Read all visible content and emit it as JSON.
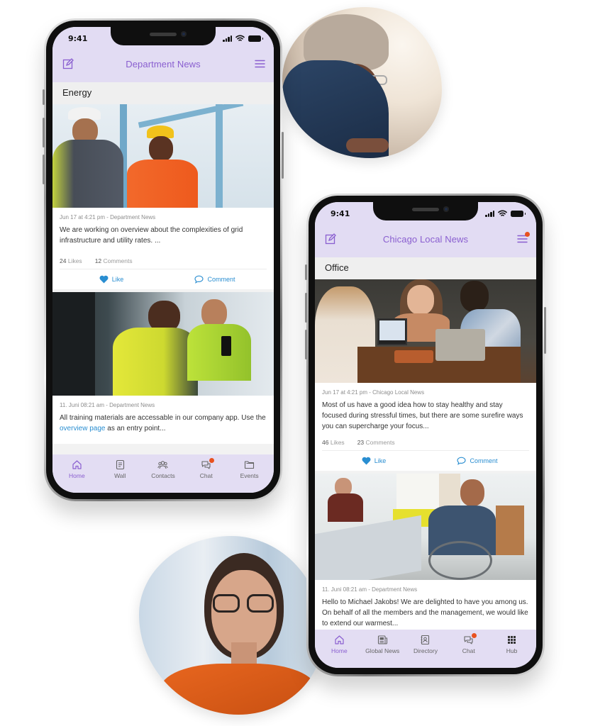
{
  "phones": [
    {
      "status_time": "9:41",
      "header_title": "Department News",
      "section": "Energy",
      "menu_badge": false,
      "posts": [
        {
          "image": "workers-hardhats-photo",
          "meta": "Jun 17 at 4:21 pm - Department News",
          "text": "We are working  on overview about the complexities of grid infrastructure and utility rates. ...",
          "likes_count": "24",
          "likes_label": "Likes",
          "comments_count": "12",
          "comments_label": "Comments",
          "like_button": "Like",
          "comment_button": "Comment"
        },
        {
          "image": "workers-in-vehicle-photo",
          "meta": "11. Juni 08:21 am - Department News",
          "text_before_link": "All training materials are accessable in our company app. Use the ",
          "link": "overview page",
          "text_after_link": " as an entry point..."
        }
      ],
      "tabs": [
        {
          "label": "Home",
          "icon": "home-icon",
          "active": true
        },
        {
          "label": "Wall",
          "icon": "wall-icon",
          "active": false
        },
        {
          "label": "Contacts",
          "icon": "contacts-icon",
          "active": false
        },
        {
          "label": "Chat",
          "icon": "chat-icon",
          "active": false,
          "badge": true
        },
        {
          "label": "Events",
          "icon": "folder-icon",
          "active": false
        }
      ]
    },
    {
      "status_time": "9:41",
      "header_title": "Chicago Local News",
      "section": "Office",
      "menu_badge": true,
      "posts": [
        {
          "image": "coworkers-laptops-photo",
          "meta": "Jun 17 at 4:21 pm - Chicago Local News",
          "text": "Most of us have a good idea how to stay healthy and stay focused during stressful times, but there are some surefire ways you can supercharge your focus...",
          "likes_count": "46",
          "likes_label": "Likes",
          "comments_count": "23",
          "comments_label": "Comments",
          "like_button": "Like",
          "comment_button": "Comment"
        },
        {
          "image": "office-meeting-wheelchair-photo",
          "meta": "11. Juni 08:21 am - Department News",
          "text": "Hello to Michael Jakobs! We are delighted to have you among us. On behalf of all the members and the management, we would like to extend our warmest..."
        }
      ],
      "tabs": [
        {
          "label": "Home",
          "icon": "home-icon",
          "active": true
        },
        {
          "label": "Global News",
          "icon": "news-icon",
          "active": false
        },
        {
          "label": "Directory",
          "icon": "directory-icon",
          "active": false
        },
        {
          "label": "Chat",
          "icon": "chat-icon",
          "active": false,
          "badge": true
        },
        {
          "label": "Hub",
          "icon": "grid-icon",
          "active": false
        }
      ]
    }
  ],
  "decorative_photos": [
    "woman-with-phone-photo",
    "woman-with-glasses-photo"
  ],
  "colors": {
    "header_bg": "#e2dcf3",
    "accent_purple": "#8a5fd0",
    "link_blue": "#2a8ed1",
    "badge_orange": "#e8511f"
  }
}
